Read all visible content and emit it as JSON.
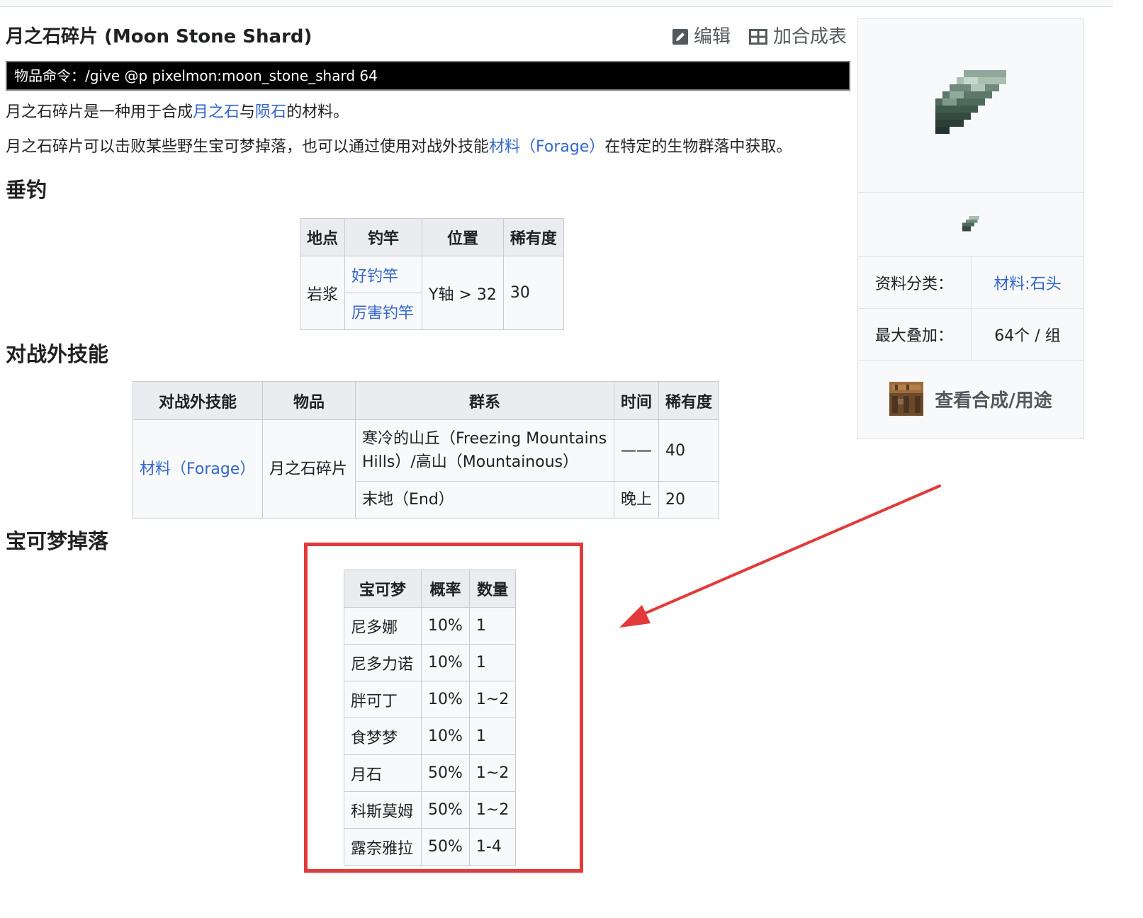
{
  "page": {
    "title": "月之石碎片 (Moon Stone Shard)",
    "edit_label": "编辑",
    "crafting_table_label": "加合成表",
    "command": "物品命令：/give @p pixelmon:moon_stone_shard 64"
  },
  "intro": {
    "p1_a": "月之石碎片是一种用于合成",
    "p1_link1": "月之石",
    "p1_mid": "与",
    "p1_link2": "陨石",
    "p1_end": "的材料。",
    "p2_a": "月之石碎片可以击败某些野生宝可梦掉落，也可以通过使用对战外技能",
    "p2_link": "材料（Forage）",
    "p2_end": "在特定的生物群落中获取。"
  },
  "fishing": {
    "heading": "垂钓",
    "headers": [
      "地点",
      "钓竿",
      "位置",
      "稀有度"
    ],
    "location": "岩浆",
    "rods": [
      "好钓竿",
      "厉害钓竿"
    ],
    "position": "Y轴 > 32",
    "rarity": "30"
  },
  "forage": {
    "heading": "对战外技能",
    "headers": [
      "对战外技能",
      "物品",
      "群系",
      "时间",
      "稀有度"
    ],
    "skill": "材料（Forage）",
    "item": "月之石碎片",
    "rows": [
      {
        "biome_line1": "寒冷的山丘（Freezing Mountains",
        "biome_line2": "Hills）/高山（Mountainous）",
        "time": "——",
        "rarity": "40"
      },
      {
        "biome_line1": "末地（End）",
        "time": "晚上",
        "rarity": "20"
      }
    ]
  },
  "drops": {
    "heading": "宝可梦掉落",
    "headers": [
      "宝可梦",
      "概率",
      "数量"
    ],
    "rows": [
      [
        "尼多娜",
        "10%",
        "1"
      ],
      [
        "尼多力诺",
        "10%",
        "1"
      ],
      [
        "胖可丁",
        "10%",
        "1~2"
      ],
      [
        "食梦梦",
        "10%",
        "1"
      ],
      [
        "月石",
        "50%",
        "1~2"
      ],
      [
        "科斯莫姆",
        "50%",
        "1~2"
      ],
      [
        "露奈雅拉",
        "50%",
        "1-4"
      ]
    ]
  },
  "infobox": {
    "category_label": "资料分类：",
    "category_value": "材料:石头",
    "stack_label": "最大叠加：",
    "stack_value": "64个 / 组",
    "craft_label": "查看合成/用途"
  },
  "colors": {
    "link": "#3366cc",
    "highlight_box": "#e23a3a",
    "arrow": "#e23a3a"
  }
}
